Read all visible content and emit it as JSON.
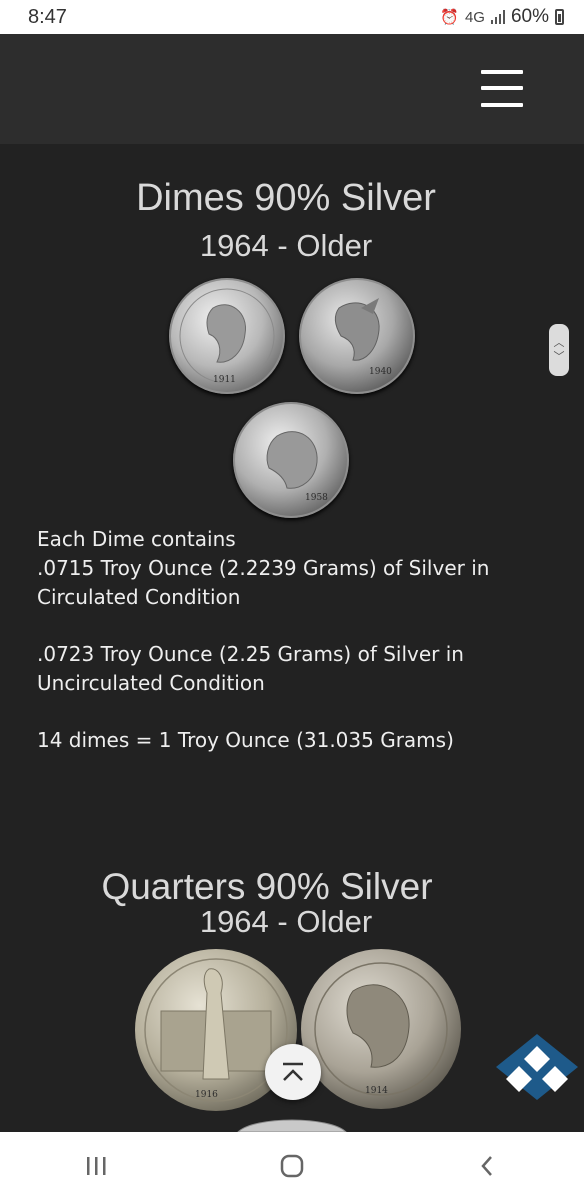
{
  "status_bar": {
    "time": "8:47",
    "network": "4G",
    "battery": "60%"
  },
  "page": {
    "dimes": {
      "title": "Dimes 90% Silver",
      "subtitle": "1964 - Older",
      "coins": [
        {
          "label": "1911",
          "icon": "barber-dime"
        },
        {
          "label": "1940",
          "icon": "mercury-dime"
        },
        {
          "label": "1958",
          "icon": "roosevelt-dime"
        }
      ],
      "description": {
        "line1": "Each Dime contains",
        "line2": ".0715 Troy Ounce (2.2239 Grams) of Silver in Circulated Condition",
        "line3": ".0723 Troy Ounce (2.25 Grams) of Silver  in Uncirculated Condition",
        "line4": "14 dimes = 1 Troy Ounce (31.035 Grams)"
      }
    },
    "quarters": {
      "title": "Quarters 90% Silver",
      "subtitle": "1964 - Older",
      "coins": [
        {
          "label": "1916",
          "icon": "standing-liberty-quarter"
        },
        {
          "label": "1914",
          "icon": "barber-quarter"
        }
      ]
    }
  },
  "colors": {
    "background": "#222222",
    "header": "#2d2d2d",
    "text": "#e6e6e6",
    "logo": "#1e5a8a"
  }
}
